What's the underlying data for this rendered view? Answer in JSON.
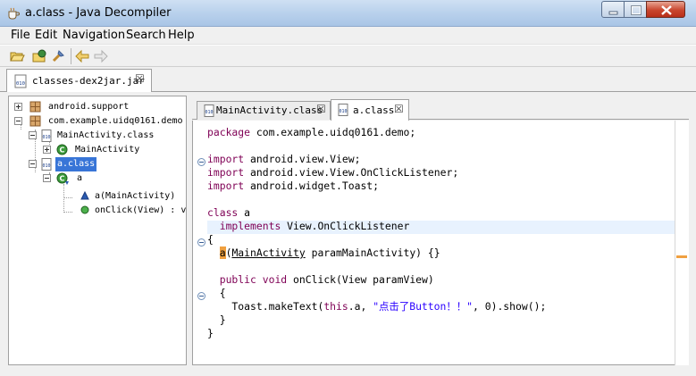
{
  "window": {
    "title": "a.class - Java Decompiler"
  },
  "menu": [
    "File",
    "Edit",
    "Navigation",
    "Search",
    "Help"
  ],
  "toolbar": {
    "icons": [
      "open-file-icon",
      "open-type-icon",
      "search-icon",
      "back-arrow-icon",
      "forward-arrow-icon"
    ]
  },
  "jar_tab": {
    "label": "classes-dex2jar.jar",
    "close": "☒"
  },
  "tree": {
    "items": [
      {
        "label": "android.support",
        "expander": "+"
      },
      {
        "label": "com.example.uidq0161.demo",
        "expander": "-"
      },
      {
        "label": "MainActivity.class",
        "expander": "-"
      },
      {
        "label": "MainActivity",
        "expander": "+"
      },
      {
        "label": "a.class",
        "expander": "-",
        "selected": true
      },
      {
        "label": "a",
        "expander": "-"
      },
      {
        "label": "a(MainActivity)"
      },
      {
        "label": "onClick(View) : v"
      }
    ]
  },
  "editor_tabs": [
    {
      "label": "MainActivity.class",
      "close": "☒",
      "active": false
    },
    {
      "label": "a.class",
      "close": "☒",
      "active": true
    }
  ],
  "code": {
    "l1_kw": "package",
    "l1_rest": " com.example.uidq0161.demo;",
    "l3_kw": "import",
    "l3_rest": " android.view.View;",
    "l4_kw": "import",
    "l4_rest": " android.view.View.OnClickListener;",
    "l5_kw": "import",
    "l5_rest": " android.widget.Toast;",
    "l7_kw": "class",
    "l7_rest": " a",
    "l8_indent": "  ",
    "l8_kw": "implements",
    "l8_rest": " View.OnClickListener",
    "l9": "{",
    "l10_indent": "  ",
    "l10_mark": "a",
    "l10_p": "(",
    "l10_ref": "MainActivity",
    "l10_rest": " paramMainActivity) {}",
    "l12_indent": "  ",
    "l12_kw1": "public",
    "l12_sp": " ",
    "l12_kw2": "void",
    "l12_rest": " onClick(View paramView)",
    "l13": "  {",
    "l14_pre": "    Toast.makeText(",
    "l14_kw": "this",
    "l14_mid": ".a, ",
    "l14_str": "\"点击了Button！！\"",
    "l14_post": ", 0).show();",
    "l15": "  }",
    "l16": "}"
  },
  "colors": {
    "keyword": "#7f0055",
    "string": "#2a00ff",
    "selection": "#3875d7",
    "current_line": "#e8f2fe"
  }
}
